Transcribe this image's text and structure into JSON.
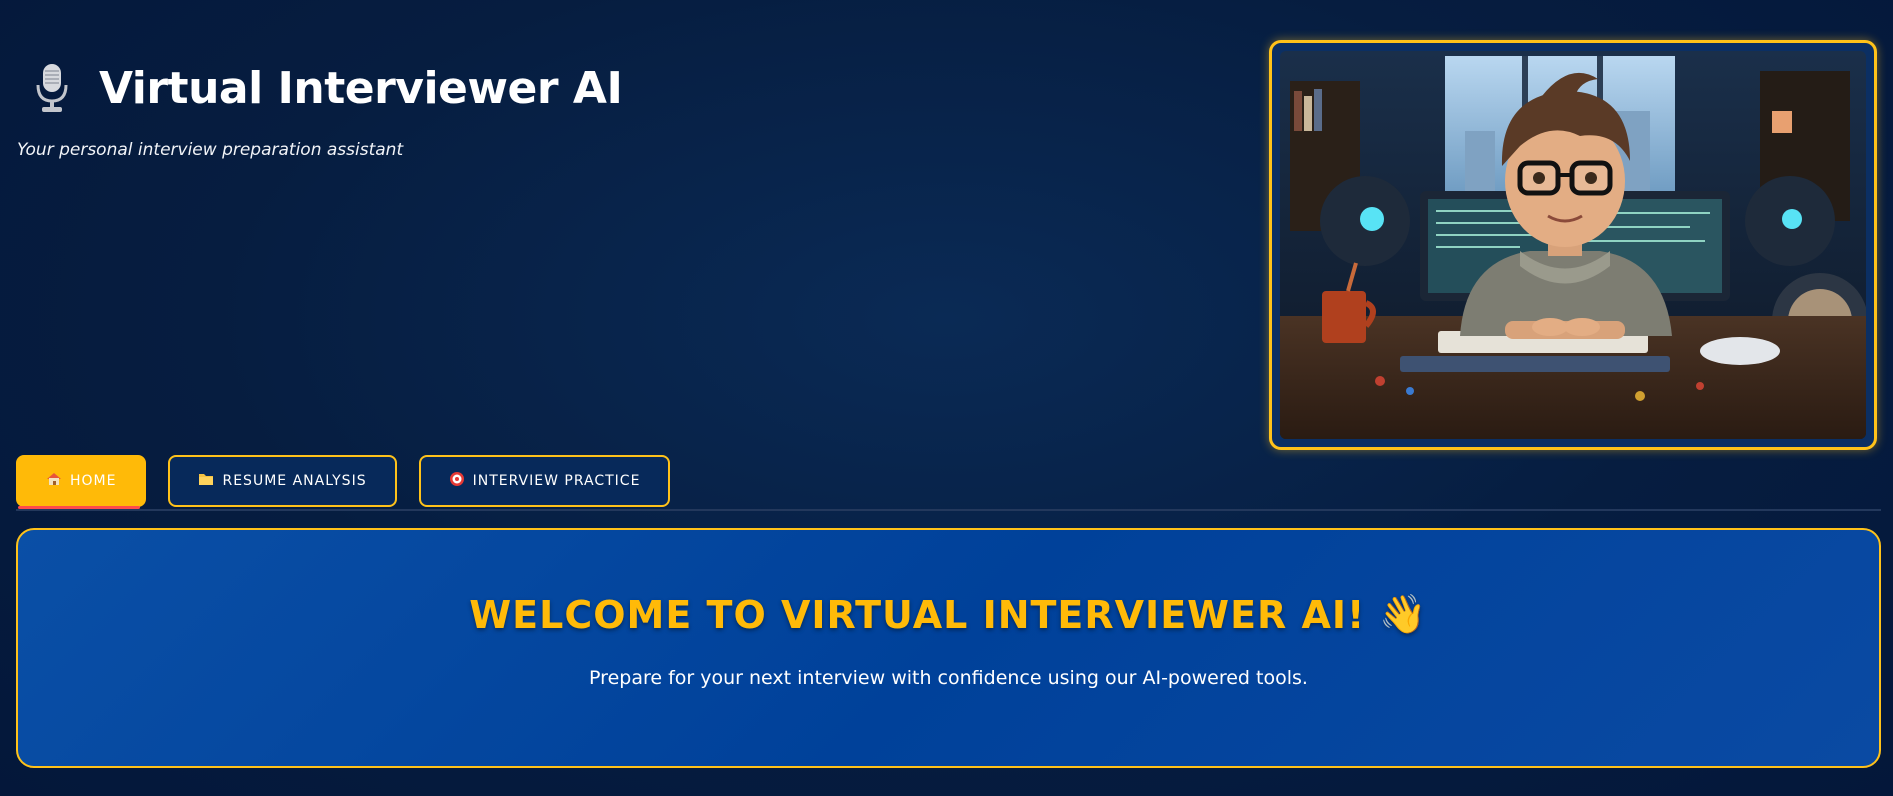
{
  "app": {
    "title": "Virtual Interviewer AI",
    "subtitle": "Your personal interview preparation assistant",
    "title_icon": "microphone-icon"
  },
  "hero": {
    "image": "cartoon-developer-at-desk-illustration"
  },
  "tabs": [
    {
      "label": "HOME",
      "icon": "house",
      "active": true
    },
    {
      "label": "RESUME ANALYSIS",
      "icon": "folder",
      "active": false
    },
    {
      "label": "INTERVIEW PRACTICE",
      "icon": "target",
      "active": false
    }
  ],
  "welcome": {
    "title": "WELCOME TO VIRTUAL INTERVIEWER AI!",
    "emoji": "👋",
    "description": "Prepare for your next interview with confidence using our AI-powered tools."
  },
  "colors": {
    "accent": "#ffba08",
    "background": "#061d40",
    "card": "#00419a",
    "active_underline": "#ff4b4b"
  }
}
